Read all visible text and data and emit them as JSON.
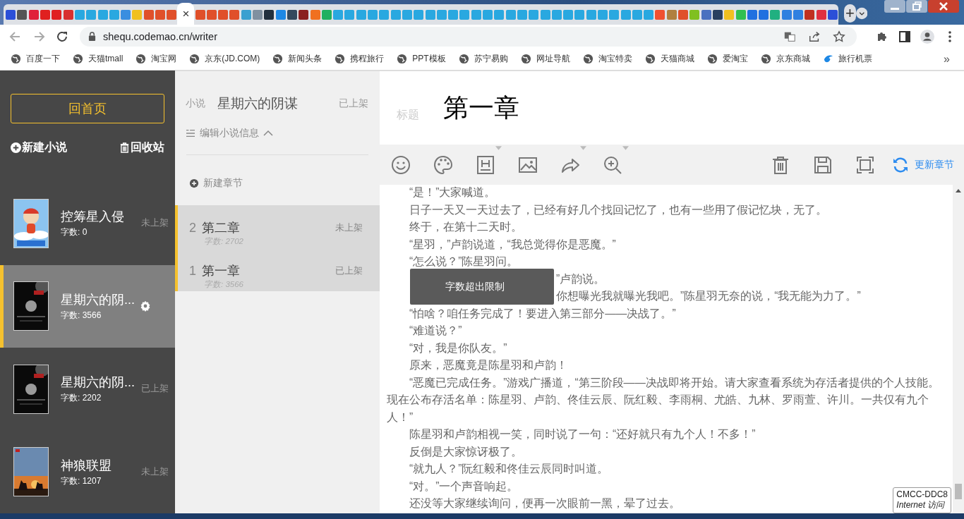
{
  "browser": {
    "tabs": [
      {
        "selected": false,
        "color": "#2b4fd8"
      },
      {
        "selected": false,
        "color": "#555555"
      },
      {
        "selected": false,
        "color": "#e0203a"
      },
      {
        "selected": false,
        "color": "#e02020"
      },
      {
        "selected": false,
        "color": "#e02020"
      },
      {
        "selected": false,
        "color": "#d83030"
      },
      {
        "selected": false,
        "color": "#29a8e0"
      },
      {
        "selected": false,
        "color": "#29a8e0"
      },
      {
        "selected": false,
        "color": "#29a8e0"
      },
      {
        "selected": false,
        "color": "#29a8e0"
      },
      {
        "selected": false,
        "color": "#3a8ee0"
      },
      {
        "selected": false,
        "color": "#f0c020"
      },
      {
        "selected": false,
        "color": "#e0502a"
      },
      {
        "selected": false,
        "color": "#e0502a"
      },
      {
        "selected": false,
        "color": "#e0502a"
      },
      {
        "selected": true
      },
      {
        "selected": false,
        "color": "#e0502a"
      },
      {
        "selected": false,
        "color": "#e0502a"
      },
      {
        "selected": false,
        "color": "#e0502a"
      },
      {
        "selected": false,
        "color": "#e0502a"
      },
      {
        "selected": false,
        "color": "#3aa0d0"
      },
      {
        "selected": false,
        "color": "#8090a0"
      },
      {
        "selected": false,
        "color": "#22303e"
      },
      {
        "selected": false,
        "color": "#1e88e5"
      },
      {
        "selected": false,
        "color": "#34495e"
      },
      {
        "selected": false,
        "color": "#8a2020"
      },
      {
        "selected": false,
        "color": "#f07020"
      },
      {
        "selected": false,
        "color": "#20b060"
      },
      {
        "selected": false,
        "color": "#29a8e0"
      },
      {
        "selected": false,
        "color": "#29a8e0"
      },
      {
        "selected": false,
        "color": "#29a8e0"
      },
      {
        "selected": false,
        "color": "#29a8e0"
      },
      {
        "selected": false,
        "color": "#29a8e0"
      },
      {
        "selected": false,
        "color": "#29a8e0"
      },
      {
        "selected": false,
        "color": "#29a8e0"
      },
      {
        "selected": false,
        "color": "#29a8e0"
      },
      {
        "selected": false,
        "color": "#29a8e0"
      },
      {
        "selected": false,
        "color": "#29a8e0"
      },
      {
        "selected": false,
        "color": "#29a8e0"
      },
      {
        "selected": false,
        "color": "#29a8e0"
      },
      {
        "selected": false,
        "color": "#29a8e0"
      },
      {
        "selected": false,
        "color": "#29a8e0"
      },
      {
        "selected": false,
        "color": "#29a8e0"
      },
      {
        "selected": false,
        "color": "#29a8e0"
      },
      {
        "selected": false,
        "color": "#29a8e0"
      },
      {
        "selected": false,
        "color": "#29a8e0"
      },
      {
        "selected": false,
        "color": "#29a8e0"
      },
      {
        "selected": false,
        "color": "#29a8e0"
      },
      {
        "selected": false,
        "color": "#29a8e0"
      },
      {
        "selected": false,
        "color": "#29a8e0"
      },
      {
        "selected": false,
        "color": "#29a8e0"
      },
      {
        "selected": false,
        "color": "#29a8e0"
      },
      {
        "selected": false,
        "color": "#29a8e0"
      },
      {
        "selected": false,
        "color": "#29a8e0"
      },
      {
        "selected": false,
        "color": "#29a8e0"
      },
      {
        "selected": false,
        "color": "#29a8e0"
      },
      {
        "selected": false,
        "color": "#f05030"
      },
      {
        "selected": false,
        "color": "#b08040"
      },
      {
        "selected": false,
        "color": "#e0502a"
      },
      {
        "selected": false,
        "color": "#80c020"
      },
      {
        "selected": false,
        "color": "#4a70c0"
      },
      {
        "selected": false,
        "color": "#2a4060"
      },
      {
        "selected": false,
        "color": "#f0c020"
      },
      {
        "selected": false,
        "color": "#30c050"
      },
      {
        "selected": false,
        "color": "#2070e0"
      },
      {
        "selected": false,
        "color": "#2070e0"
      },
      {
        "selected": false,
        "color": "#20b080"
      },
      {
        "selected": false,
        "color": "#3080e0"
      },
      {
        "selected": false,
        "color": "#3080e0"
      },
      {
        "selected": false,
        "color": "#c03020"
      },
      {
        "selected": false,
        "color": "#e03040"
      },
      {
        "selected": false,
        "color": "#2b4fd8"
      }
    ],
    "close_tab": "×",
    "new_tab": "+",
    "url": "shequ.codemao.cn/writer",
    "bookmarks": [
      {
        "kind": "globe",
        "label": "百度一下"
      },
      {
        "kind": "globe",
        "label": "天猫tmall"
      },
      {
        "kind": "globe",
        "label": "淘宝网"
      },
      {
        "kind": "globe",
        "label": "京东(JD.COM)"
      },
      {
        "kind": "globe",
        "label": "新闻头条"
      },
      {
        "kind": "globe",
        "label": "携程旅行"
      },
      {
        "kind": "globe",
        "label": "PPT模板"
      },
      {
        "kind": "globe",
        "label": "苏宁易购"
      },
      {
        "kind": "globe",
        "label": "网址导航"
      },
      {
        "kind": "globe",
        "label": "淘宝特卖"
      },
      {
        "kind": "globe",
        "label": "天猫商城"
      },
      {
        "kind": "globe",
        "label": "爱淘宝"
      },
      {
        "kind": "globe",
        "label": "京东商城"
      },
      {
        "kind": "bird",
        "label": "旅行机票"
      }
    ],
    "more_bookmarks": "»"
  },
  "sidebar": {
    "home_button": "回首页",
    "new_novel": "新建小说",
    "recycle_bin": "回收站",
    "novels": [
      {
        "title": "控筹星入侵",
        "count": "字数: 0",
        "status": "未上架",
        "selected": false
      },
      {
        "title": "星期六的阴...",
        "count": "字数: 3566",
        "selected": true
      },
      {
        "title": "星期六的阴...",
        "count": "字数: 2202",
        "status": "已上架",
        "selected": false
      },
      {
        "title": "神狼联盟",
        "count": "字数: 1207",
        "status": "未上架",
        "selected": false
      }
    ]
  },
  "chapters_panel": {
    "label": "小说",
    "novel_title": "星期六的阴谋",
    "status": "已上架",
    "edit_info": "编辑小说信息",
    "new_chapter": "新建章节",
    "chapters": [
      {
        "number": "2",
        "title": "第二章",
        "count": "字数: 2702",
        "status": "未上架",
        "selected": true
      },
      {
        "number": "1",
        "title": "第一章",
        "count": "字数: 3566",
        "status": "已上架",
        "selected": true
      }
    ]
  },
  "editor": {
    "title_label": "标题",
    "title": "第一章",
    "update_button": "更新章节",
    "paragraphs": [
      {
        "kind": "plain",
        "text": "“是！”大家喊道。"
      },
      {
        "kind": "plain",
        "text": "日子一天又一天过去了，已经有好几个找回记忆了，也有一些用了假记忆块，无了。"
      },
      {
        "kind": "plain",
        "text": "终于，在第十二天时。"
      },
      {
        "kind": "plain",
        "text": "“星羽，”卢韵说道，“我总觉得你是恶魔。”"
      },
      {
        "kind": "plain",
        "text": "“怎么说？”陈星羽问。"
      },
      {
        "kind": "covered",
        "text": "”卢韵说。"
      },
      {
        "kind": "covered",
        "text": "你想曝光我就曝光我吧。”陈星羽无奈的说，“我无能为力了。”"
      },
      {
        "kind": "plain",
        "text": "“怕啥？咱任务完成了！要进入第三部分——决战了。”"
      },
      {
        "kind": "plain",
        "text": "“难道说？”"
      },
      {
        "kind": "plain",
        "text": "“对，我是你队友。”"
      },
      {
        "kind": "plain",
        "text": "原来，恶魔竟是陈星羽和卢韵！"
      },
      {
        "kind": "plain",
        "text": "“恶魔已完成任务。”游戏广播道，“第三阶段——决战即将开始。请大家查看系统为存活者提供的个人技能。现在公布存活名单：陈星羽、卢韵、佟佳云辰、阮红毅、李雨桐、尤皓、九林、罗雨萱、许川。一共仅有九个人！”"
      },
      {
        "kind": "plain",
        "text": "陈星羽和卢韵相视一笑，同时说了一句：“还好就只有九个人！不多！”"
      },
      {
        "kind": "plain",
        "text": "反倒是大家惊讶极了。"
      },
      {
        "kind": "plain",
        "text": "“就九人？”阮红毅和佟佳云辰同时叫道。"
      },
      {
        "kind": "plain",
        "text": "“对。”一个声音响起。"
      },
      {
        "kind": "plain",
        "text": "还没等大家继续询问，便再一次眼前一黑，晕了过去。"
      }
    ],
    "tooltip": "字数超出限制"
  },
  "network_tooltip": {
    "name": "CMCC-DDC8",
    "status": "Internet 访问"
  }
}
